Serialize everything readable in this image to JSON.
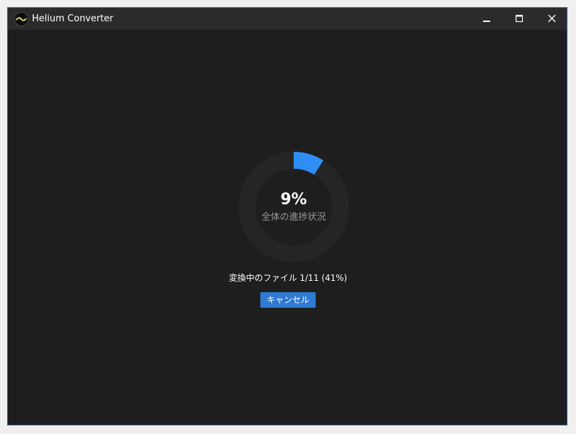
{
  "window": {
    "title": "Helium Converter"
  },
  "progress": {
    "overall_percent": 9,
    "percent_text": "9%",
    "overall_label": "全体の進捗状況",
    "file_status": "変換中のファイル 1/11 (41%)"
  },
  "actions": {
    "cancel_label": "キャンセル"
  },
  "colors": {
    "accent": "#2f8ef5",
    "track": "#252525",
    "background": "#1e1e1e",
    "titlebar": "#2b2b2b",
    "button": "#2f7ad1"
  },
  "icons": {
    "app": "helium-logo-icon",
    "minimize": "minimize-icon",
    "maximize": "maximize-icon",
    "close": "close-icon"
  }
}
